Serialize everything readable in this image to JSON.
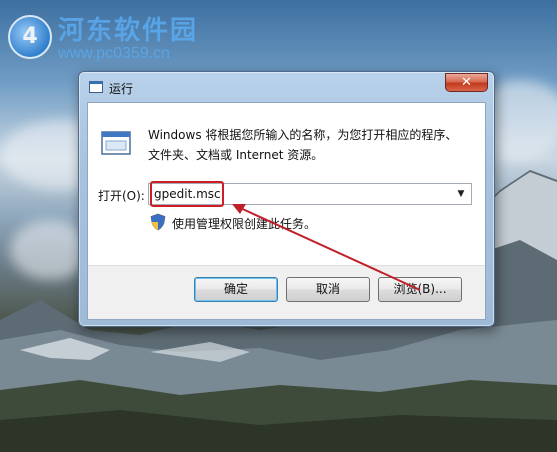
{
  "watermark": {
    "logo_glyph": "4",
    "title": "河东软件园",
    "url": "www.pc0359.cn"
  },
  "window": {
    "title": "运行",
    "close_glyph": "✕",
    "description": "Windows 将根据您所输入的名称，为您打开相应的程序、文件夹、文档或 Internet 资源。",
    "open_label": "打开(O):",
    "open_value": "gpedit.msc",
    "admin_note": "使用管理权限创建此任务。",
    "buttons": {
      "ok": "确定",
      "cancel": "取消",
      "browse": "浏览(B)..."
    }
  },
  "colors": {
    "highlight": "#d01c24",
    "arrow": "#c0202a"
  }
}
